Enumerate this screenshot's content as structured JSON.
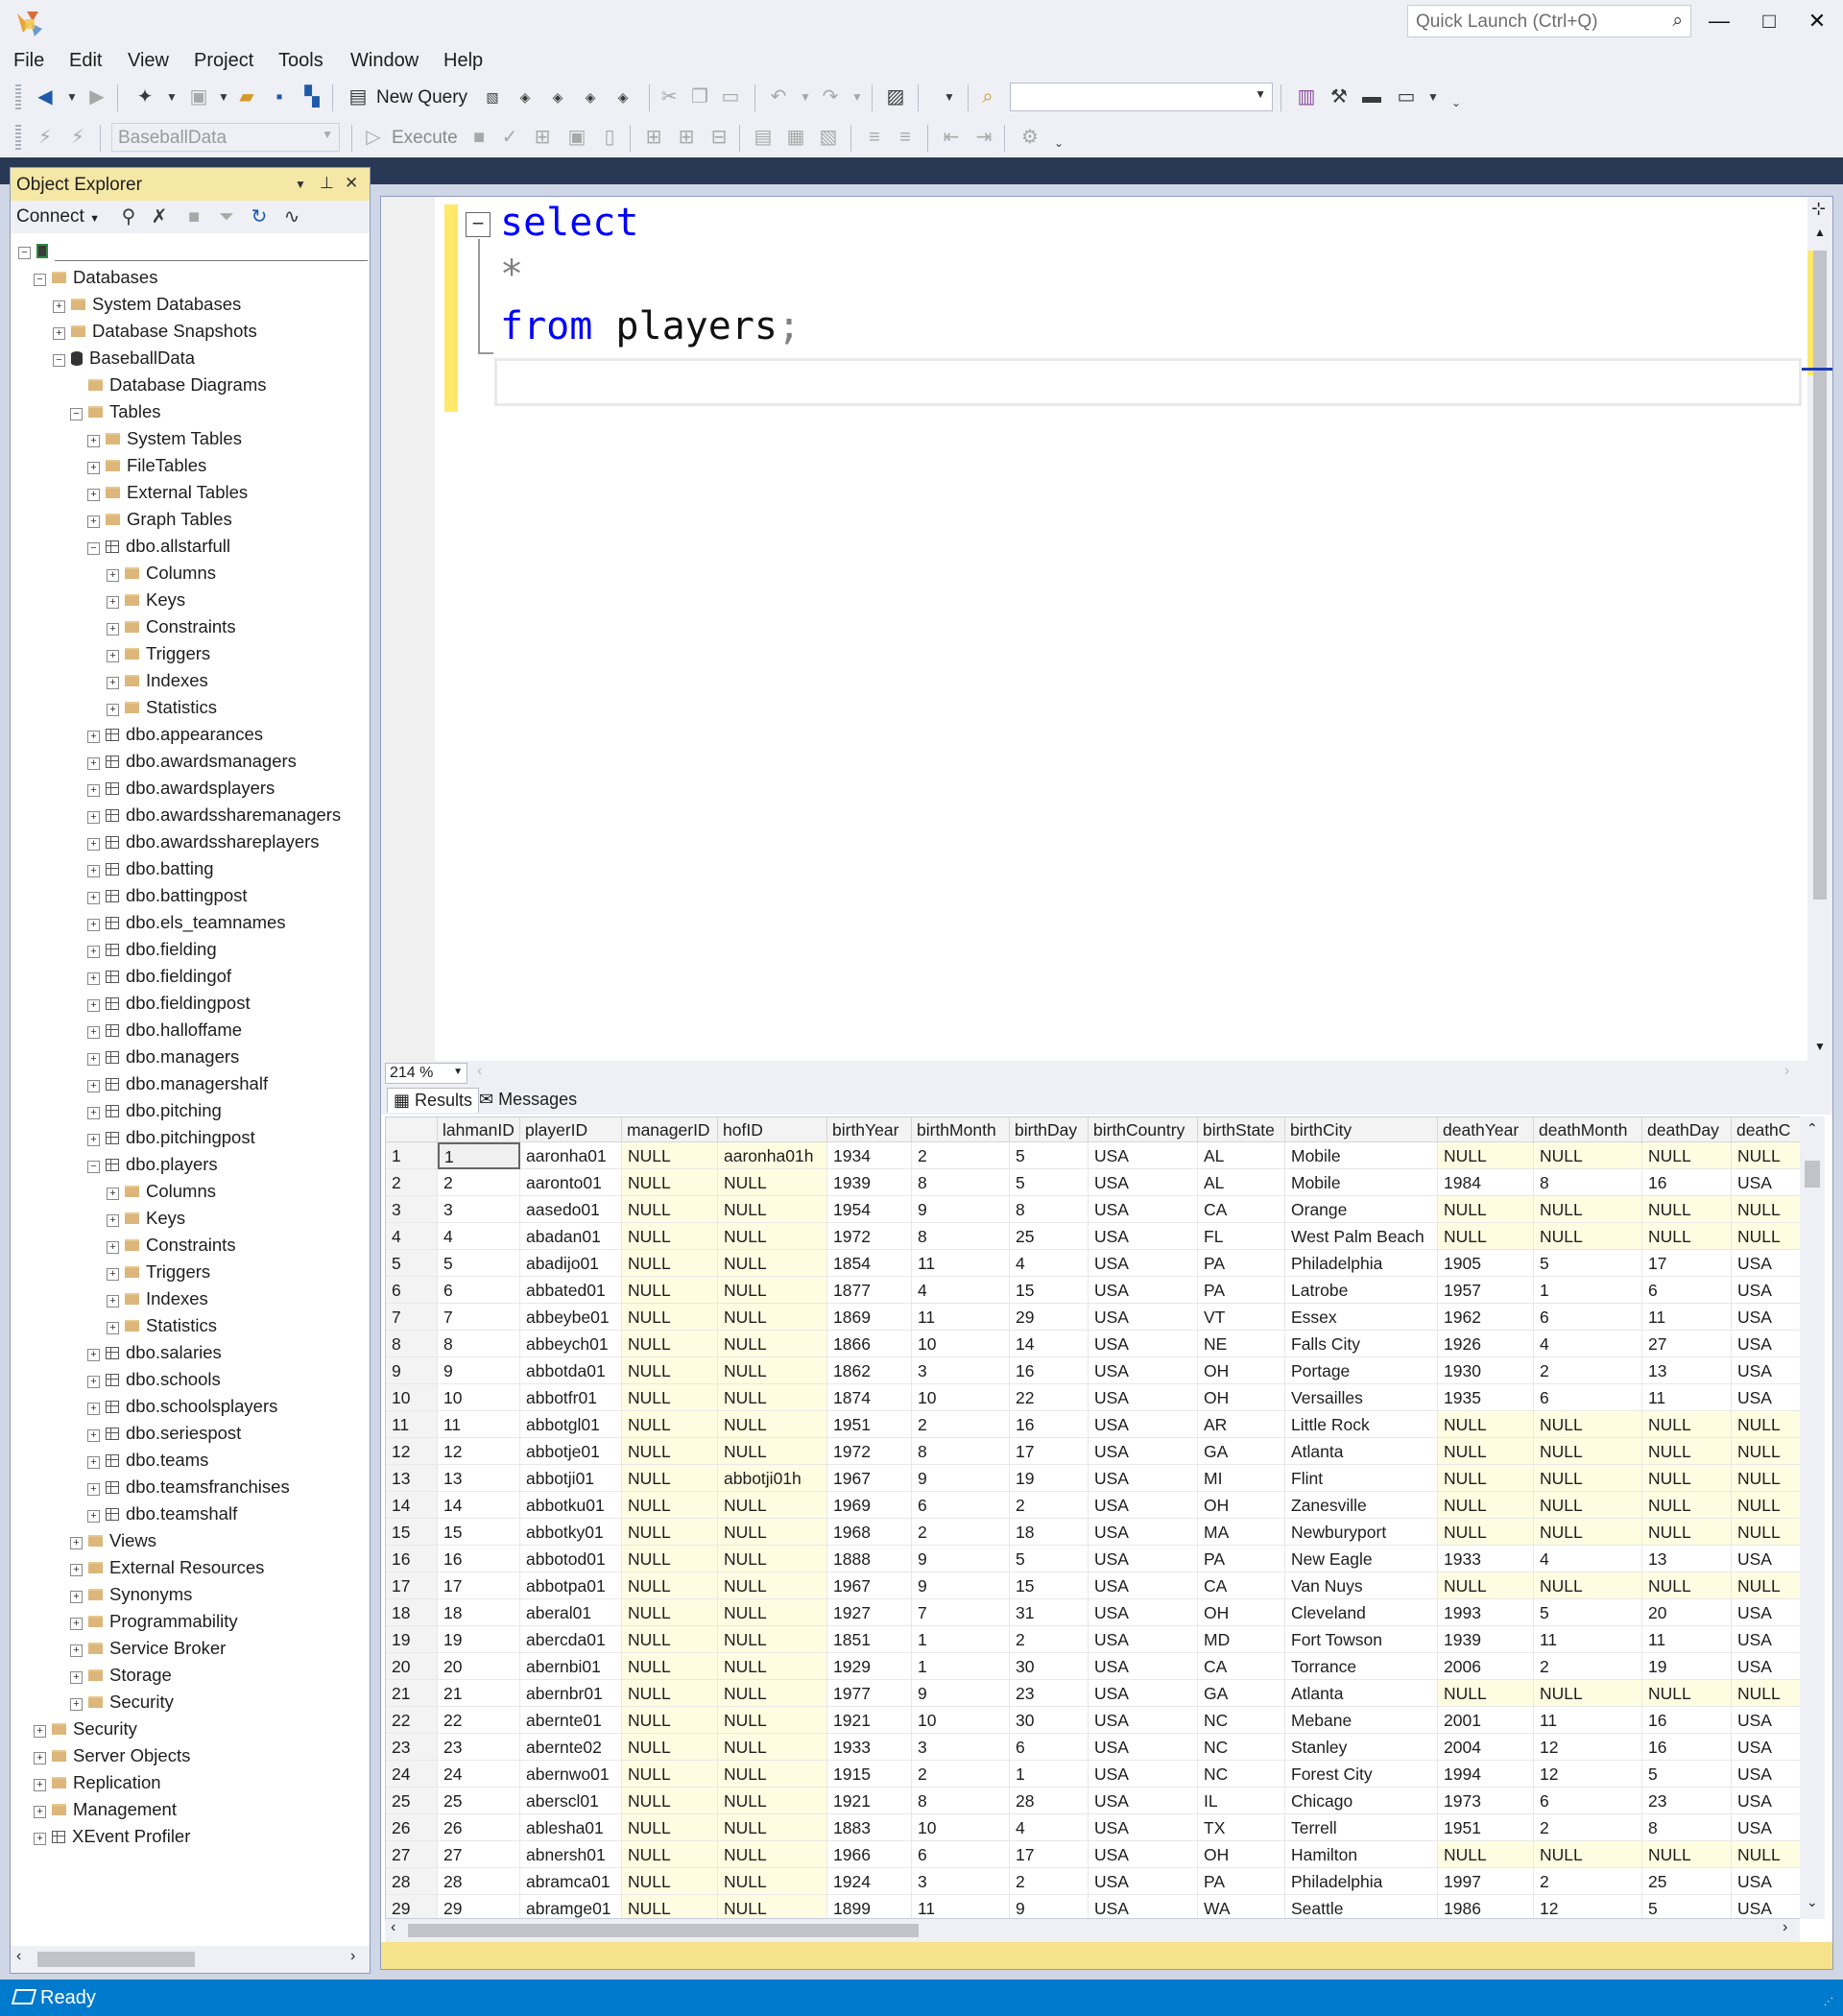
{
  "quick_launch": {
    "placeholder": "Quick Launch (Ctrl+Q)"
  },
  "window_controls": {
    "minimize": "—",
    "maximize": "□",
    "close": "✕"
  },
  "menu": [
    "File",
    "Edit",
    "View",
    "Project",
    "Tools",
    "Window",
    "Help"
  ],
  "toolbar": {
    "new_query": "New Query",
    "execute": "Execute",
    "database": "BaseballData",
    "solution_config": ""
  },
  "object_explorer": {
    "title": "Object Explorer",
    "connect": "Connect",
    "server_name": "",
    "tree": [
      {
        "label": "Databases",
        "level": 1,
        "icon": "folder",
        "state": "expanded"
      },
      {
        "label": "System Databases",
        "level": 2,
        "icon": "folder",
        "state": "collapsed"
      },
      {
        "label": "Database Snapshots",
        "level": 2,
        "icon": "folder",
        "state": "collapsed"
      },
      {
        "label": "BaseballData",
        "level": 2,
        "icon": "database",
        "state": "expanded"
      },
      {
        "label": "Database Diagrams",
        "level": 3,
        "icon": "folder",
        "state": "none"
      },
      {
        "label": "Tables",
        "level": 3,
        "icon": "folder",
        "state": "expanded"
      },
      {
        "label": "System Tables",
        "level": 4,
        "icon": "folder",
        "state": "collapsed"
      },
      {
        "label": "FileTables",
        "level": 4,
        "icon": "folder",
        "state": "collapsed"
      },
      {
        "label": "External Tables",
        "level": 4,
        "icon": "folder",
        "state": "collapsed"
      },
      {
        "label": "Graph Tables",
        "level": 4,
        "icon": "folder",
        "state": "collapsed"
      },
      {
        "label": "dbo.allstarfull",
        "level": 4,
        "icon": "table",
        "state": "expanded"
      },
      {
        "label": "Columns",
        "level": 5,
        "icon": "folder",
        "state": "collapsed"
      },
      {
        "label": "Keys",
        "level": 5,
        "icon": "folder",
        "state": "collapsed"
      },
      {
        "label": "Constraints",
        "level": 5,
        "icon": "folder",
        "state": "collapsed"
      },
      {
        "label": "Triggers",
        "level": 5,
        "icon": "folder",
        "state": "collapsed"
      },
      {
        "label": "Indexes",
        "level": 5,
        "icon": "folder",
        "state": "collapsed"
      },
      {
        "label": "Statistics",
        "level": 5,
        "icon": "folder",
        "state": "collapsed"
      },
      {
        "label": "dbo.appearances",
        "level": 4,
        "icon": "table",
        "state": "collapsed"
      },
      {
        "label": "dbo.awardsmanagers",
        "level": 4,
        "icon": "table",
        "state": "collapsed"
      },
      {
        "label": "dbo.awardsplayers",
        "level": 4,
        "icon": "table",
        "state": "collapsed"
      },
      {
        "label": "dbo.awardssharemanagers",
        "level": 4,
        "icon": "table",
        "state": "collapsed"
      },
      {
        "label": "dbo.awardsshareplayers",
        "level": 4,
        "icon": "table",
        "state": "collapsed"
      },
      {
        "label": "dbo.batting",
        "level": 4,
        "icon": "table",
        "state": "collapsed"
      },
      {
        "label": "dbo.battingpost",
        "level": 4,
        "icon": "table",
        "state": "collapsed"
      },
      {
        "label": "dbo.els_teamnames",
        "level": 4,
        "icon": "table",
        "state": "collapsed"
      },
      {
        "label": "dbo.fielding",
        "level": 4,
        "icon": "table",
        "state": "collapsed"
      },
      {
        "label": "dbo.fieldingof",
        "level": 4,
        "icon": "table",
        "state": "collapsed"
      },
      {
        "label": "dbo.fieldingpost",
        "level": 4,
        "icon": "table",
        "state": "collapsed"
      },
      {
        "label": "dbo.halloffame",
        "level": 4,
        "icon": "table",
        "state": "collapsed"
      },
      {
        "label": "dbo.managers",
        "level": 4,
        "icon": "table",
        "state": "collapsed"
      },
      {
        "label": "dbo.managershalf",
        "level": 4,
        "icon": "table",
        "state": "collapsed"
      },
      {
        "label": "dbo.pitching",
        "level": 4,
        "icon": "table",
        "state": "collapsed"
      },
      {
        "label": "dbo.pitchingpost",
        "level": 4,
        "icon": "table",
        "state": "collapsed"
      },
      {
        "label": "dbo.players",
        "level": 4,
        "icon": "table",
        "state": "expanded"
      },
      {
        "label": "Columns",
        "level": 5,
        "icon": "folder",
        "state": "collapsed"
      },
      {
        "label": "Keys",
        "level": 5,
        "icon": "folder",
        "state": "collapsed"
      },
      {
        "label": "Constraints",
        "level": 5,
        "icon": "folder",
        "state": "collapsed"
      },
      {
        "label": "Triggers",
        "level": 5,
        "icon": "folder",
        "state": "collapsed"
      },
      {
        "label": "Indexes",
        "level": 5,
        "icon": "folder",
        "state": "collapsed"
      },
      {
        "label": "Statistics",
        "level": 5,
        "icon": "folder",
        "state": "collapsed"
      },
      {
        "label": "dbo.salaries",
        "level": 4,
        "icon": "table",
        "state": "collapsed"
      },
      {
        "label": "dbo.schools",
        "level": 4,
        "icon": "table",
        "state": "collapsed"
      },
      {
        "label": "dbo.schoolsplayers",
        "level": 4,
        "icon": "table",
        "state": "collapsed"
      },
      {
        "label": "dbo.seriespost",
        "level": 4,
        "icon": "table",
        "state": "collapsed"
      },
      {
        "label": "dbo.teams",
        "level": 4,
        "icon": "table",
        "state": "collapsed"
      },
      {
        "label": "dbo.teamsfranchises",
        "level": 4,
        "icon": "table",
        "state": "collapsed"
      },
      {
        "label": "dbo.teamshalf",
        "level": 4,
        "icon": "table",
        "state": "collapsed"
      },
      {
        "label": "Views",
        "level": 3,
        "icon": "folder",
        "state": "collapsed"
      },
      {
        "label": "External Resources",
        "level": 3,
        "icon": "folder",
        "state": "collapsed"
      },
      {
        "label": "Synonyms",
        "level": 3,
        "icon": "folder",
        "state": "collapsed"
      },
      {
        "label": "Programmability",
        "level": 3,
        "icon": "folder",
        "state": "collapsed"
      },
      {
        "label": "Service Broker",
        "level": 3,
        "icon": "folder",
        "state": "collapsed"
      },
      {
        "label": "Storage",
        "level": 3,
        "icon": "folder",
        "state": "collapsed"
      },
      {
        "label": "Security",
        "level": 3,
        "icon": "folder",
        "state": "collapsed"
      },
      {
        "label": "Security",
        "level": 1,
        "icon": "folder",
        "state": "collapsed"
      },
      {
        "label": "Server Objects",
        "level": 1,
        "icon": "folder",
        "state": "collapsed"
      },
      {
        "label": "Replication",
        "level": 1,
        "icon": "folder",
        "state": "collapsed"
      },
      {
        "label": "Management",
        "level": 1,
        "icon": "folder",
        "state": "collapsed"
      },
      {
        "label": "XEvent Profiler",
        "level": 1,
        "icon": "xevent",
        "state": "collapsed"
      }
    ]
  },
  "editor": {
    "lines": [
      [
        {
          "t": "select",
          "c": "kw"
        }
      ],
      [
        {
          "t": "*",
          "c": "op"
        }
      ],
      [
        {
          "t": "from",
          "c": "kw"
        },
        {
          "t": " players",
          "c": "id"
        },
        {
          "t": ";",
          "c": "op"
        }
      ]
    ],
    "zoom": "214 %"
  },
  "results": {
    "tabs": [
      "Results",
      "Messages"
    ],
    "columns": [
      "",
      "lahmanID",
      "playerID",
      "managerID",
      "hofID",
      "birthYear",
      "birthMonth",
      "birthDay",
      "birthCountry",
      "birthState",
      "birthCity",
      "deathYear",
      "deathMonth",
      "deathDay",
      "deathC"
    ],
    "rows": [
      [
        "1",
        "1",
        "aaronha01",
        "NULL",
        "aaronha01h",
        "1934",
        "2",
        "5",
        "USA",
        "AL",
        "Mobile",
        "NULL",
        "NULL",
        "NULL",
        "NULL"
      ],
      [
        "2",
        "2",
        "aaronto01",
        "NULL",
        "NULL",
        "1939",
        "8",
        "5",
        "USA",
        "AL",
        "Mobile",
        "1984",
        "8",
        "16",
        "USA"
      ],
      [
        "3",
        "3",
        "aasedo01",
        "NULL",
        "NULL",
        "1954",
        "9",
        "8",
        "USA",
        "CA",
        "Orange",
        "NULL",
        "NULL",
        "NULL",
        "NULL"
      ],
      [
        "4",
        "4",
        "abadan01",
        "NULL",
        "NULL",
        "1972",
        "8",
        "25",
        "USA",
        "FL",
        "West Palm Beach",
        "NULL",
        "NULL",
        "NULL",
        "NULL"
      ],
      [
        "5",
        "5",
        "abadijo01",
        "NULL",
        "NULL",
        "1854",
        "11",
        "4",
        "USA",
        "PA",
        "Philadelphia",
        "1905",
        "5",
        "17",
        "USA"
      ],
      [
        "6",
        "6",
        "abbated01",
        "NULL",
        "NULL",
        "1877",
        "4",
        "15",
        "USA",
        "PA",
        "Latrobe",
        "1957",
        "1",
        "6",
        "USA"
      ],
      [
        "7",
        "7",
        "abbeybe01",
        "NULL",
        "NULL",
        "1869",
        "11",
        "29",
        "USA",
        "VT",
        "Essex",
        "1962",
        "6",
        "11",
        "USA"
      ],
      [
        "8",
        "8",
        "abbeych01",
        "NULL",
        "NULL",
        "1866",
        "10",
        "14",
        "USA",
        "NE",
        "Falls City",
        "1926",
        "4",
        "27",
        "USA"
      ],
      [
        "9",
        "9",
        "abbotda01",
        "NULL",
        "NULL",
        "1862",
        "3",
        "16",
        "USA",
        "OH",
        "Portage",
        "1930",
        "2",
        "13",
        "USA"
      ],
      [
        "10",
        "10",
        "abbotfr01",
        "NULL",
        "NULL",
        "1874",
        "10",
        "22",
        "USA",
        "OH",
        "Versailles",
        "1935",
        "6",
        "11",
        "USA"
      ],
      [
        "11",
        "11",
        "abbotgl01",
        "NULL",
        "NULL",
        "1951",
        "2",
        "16",
        "USA",
        "AR",
        "Little Rock",
        "NULL",
        "NULL",
        "NULL",
        "NULL"
      ],
      [
        "12",
        "12",
        "abbotje01",
        "NULL",
        "NULL",
        "1972",
        "8",
        "17",
        "USA",
        "GA",
        "Atlanta",
        "NULL",
        "NULL",
        "NULL",
        "NULL"
      ],
      [
        "13",
        "13",
        "abbotji01",
        "NULL",
        "abbotji01h",
        "1967",
        "9",
        "19",
        "USA",
        "MI",
        "Flint",
        "NULL",
        "NULL",
        "NULL",
        "NULL"
      ],
      [
        "14",
        "14",
        "abbotku01",
        "NULL",
        "NULL",
        "1969",
        "6",
        "2",
        "USA",
        "OH",
        "Zanesville",
        "NULL",
        "NULL",
        "NULL",
        "NULL"
      ],
      [
        "15",
        "15",
        "abbotky01",
        "NULL",
        "NULL",
        "1968",
        "2",
        "18",
        "USA",
        "MA",
        "Newburyport",
        "NULL",
        "NULL",
        "NULL",
        "NULL"
      ],
      [
        "16",
        "16",
        "abbotod01",
        "NULL",
        "NULL",
        "1888",
        "9",
        "5",
        "USA",
        "PA",
        "New Eagle",
        "1933",
        "4",
        "13",
        "USA"
      ],
      [
        "17",
        "17",
        "abbotpa01",
        "NULL",
        "NULL",
        "1967",
        "9",
        "15",
        "USA",
        "CA",
        "Van Nuys",
        "NULL",
        "NULL",
        "NULL",
        "NULL"
      ],
      [
        "18",
        "18",
        "aberal01",
        "NULL",
        "NULL",
        "1927",
        "7",
        "31",
        "USA",
        "OH",
        "Cleveland",
        "1993",
        "5",
        "20",
        "USA"
      ],
      [
        "19",
        "19",
        "abercda01",
        "NULL",
        "NULL",
        "1851",
        "1",
        "2",
        "USA",
        "MD",
        "Fort Towson",
        "1939",
        "11",
        "11",
        "USA"
      ],
      [
        "20",
        "20",
        "abernbi01",
        "NULL",
        "NULL",
        "1929",
        "1",
        "30",
        "USA",
        "CA",
        "Torrance",
        "2006",
        "2",
        "19",
        "USA"
      ],
      [
        "21",
        "21",
        "abernbr01",
        "NULL",
        "NULL",
        "1977",
        "9",
        "23",
        "USA",
        "GA",
        "Atlanta",
        "NULL",
        "NULL",
        "NULL",
        "NULL"
      ],
      [
        "22",
        "22",
        "abernte01",
        "NULL",
        "NULL",
        "1921",
        "10",
        "30",
        "USA",
        "NC",
        "Mebane",
        "2001",
        "11",
        "16",
        "USA"
      ],
      [
        "23",
        "23",
        "abernte02",
        "NULL",
        "NULL",
        "1933",
        "3",
        "6",
        "USA",
        "NC",
        "Stanley",
        "2004",
        "12",
        "16",
        "USA"
      ],
      [
        "24",
        "24",
        "abernwo01",
        "NULL",
        "NULL",
        "1915",
        "2",
        "1",
        "USA",
        "NC",
        "Forest City",
        "1994",
        "12",
        "5",
        "USA"
      ],
      [
        "25",
        "25",
        "aberscl01",
        "NULL",
        "NULL",
        "1921",
        "8",
        "28",
        "USA",
        "IL",
        "Chicago",
        "1973",
        "6",
        "23",
        "USA"
      ],
      [
        "26",
        "26",
        "ablesha01",
        "NULL",
        "NULL",
        "1883",
        "10",
        "4",
        "USA",
        "TX",
        "Terrell",
        "1951",
        "2",
        "8",
        "USA"
      ],
      [
        "27",
        "27",
        "abnersh01",
        "NULL",
        "NULL",
        "1966",
        "6",
        "17",
        "USA",
        "OH",
        "Hamilton",
        "NULL",
        "NULL",
        "NULL",
        "NULL"
      ],
      [
        "28",
        "28",
        "abramca01",
        "NULL",
        "NULL",
        "1924",
        "3",
        "2",
        "USA",
        "PA",
        "Philadelphia",
        "1997",
        "2",
        "25",
        "USA"
      ],
      [
        "29",
        "29",
        "abramge01",
        "NULL",
        "NULL",
        "1899",
        "11",
        "9",
        "USA",
        "WA",
        "Seattle",
        "1986",
        "12",
        "5",
        "USA"
      ]
    ]
  },
  "status": {
    "text": "Ready"
  },
  "colors": {
    "accent": "#007acc",
    "null_cell": "#fffde1",
    "keyword": "#0000ff",
    "oe_header": "#f5e7a6"
  }
}
